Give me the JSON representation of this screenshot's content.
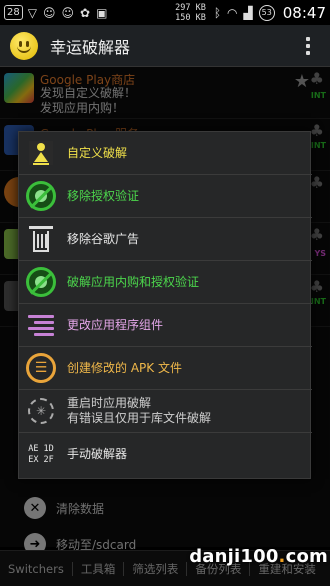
{
  "status_bar": {
    "badge": "28",
    "net_up": "297 KB",
    "net_down": "150 KB",
    "battery": "53",
    "time": "08:47"
  },
  "app": {
    "title": "幸运破解器"
  },
  "background_list": {
    "first_item": {
      "title": "Google Play商店",
      "line1": "发现自定义破解！",
      "line2": "发现应用内购！",
      "tag": "INT"
    },
    "second_item_title": "Google Play 服务",
    "row_tags": [
      "INT",
      "YS",
      "INT"
    ],
    "actions": [
      {
        "label": "清除数据",
        "icon": "close-circle-icon"
      },
      {
        "label": "移动至/sdcard",
        "icon": "move-arrow-icon"
      }
    ]
  },
  "tabs": [
    "Switchers",
    "工具箱",
    "筛选列表",
    "备份列表",
    "重建和安装"
  ],
  "watermark": {
    "text_a": "danji100",
    "dot": ".",
    "text_b": "com"
  },
  "menu": {
    "items": [
      {
        "label": "自定义破解",
        "color": "#f0e04a",
        "icon": "custom-patch-icon"
      },
      {
        "label": "移除授权验证",
        "color": "#4cd64c",
        "icon": "license-ban-icon"
      },
      {
        "label": "移除谷歌广告",
        "color": "#e8e8e8",
        "icon": "trash-icon"
      },
      {
        "label": "破解应用内购和授权验证",
        "color": "#4cd64c",
        "icon": "purchase-ban-icon"
      },
      {
        "label": "更改应用程序组件",
        "color": "#e3a6e8",
        "icon": "components-icon"
      },
      {
        "label": "创建修改的 APK 文件",
        "color": "#f0b84a",
        "icon": "apk-file-icon"
      },
      {
        "label_line1": "重启时应用破解",
        "label_line2": "有错误且仅用于库文件破解",
        "color": "#cfcfcf",
        "icon": "restart-icon"
      },
      {
        "label": "手动破解器",
        "color": "#e8e8e8",
        "icon": "hex-editor-icon",
        "hex_line1": "AE 1D",
        "hex_line2": "EX 2F"
      }
    ]
  }
}
